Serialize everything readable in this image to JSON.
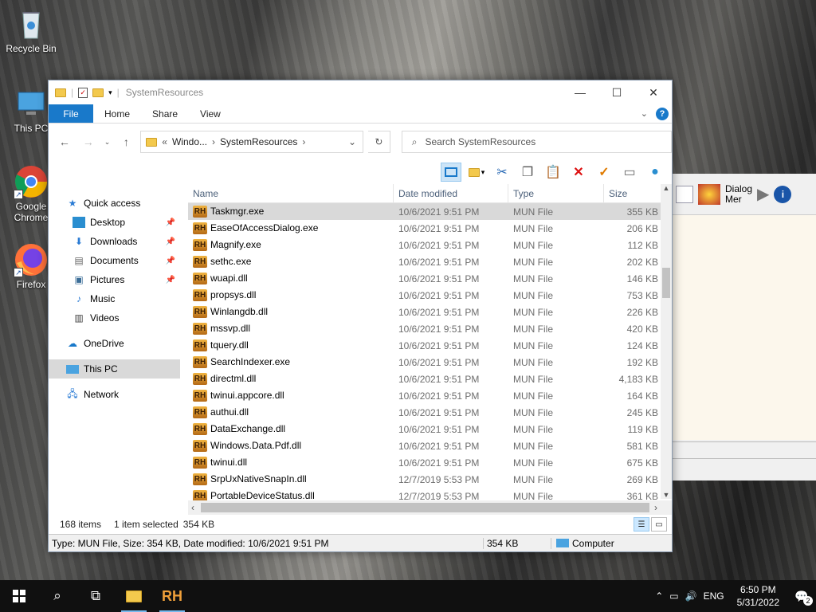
{
  "desktop": {
    "icons": [
      {
        "label": "Recycle Bin"
      },
      {
        "label": "This PC"
      },
      {
        "label": "Google Chrome"
      },
      {
        "label": "Firefox"
      }
    ]
  },
  "bg_app": {
    "dialog_label": "Dialog",
    "menu_label": "Mer"
  },
  "window": {
    "title": "SystemResources",
    "tabs": {
      "file": "File",
      "home": "Home",
      "share": "Share",
      "view": "View"
    },
    "address": {
      "part1": "Windo...",
      "part2": "SystemResources"
    },
    "search_placeholder": "Search SystemResources",
    "nav": {
      "quick_access": "Quick access",
      "desktop": "Desktop",
      "downloads": "Downloads",
      "documents": "Documents",
      "pictures": "Pictures",
      "music": "Music",
      "videos": "Videos",
      "onedrive": "OneDrive",
      "this_pc": "This PC",
      "network": "Network"
    },
    "columns": {
      "name": "Name",
      "date": "Date modified",
      "type": "Type",
      "size": "Size"
    },
    "files": [
      {
        "name": "Taskmgr.exe",
        "date": "10/6/2021 9:51 PM",
        "type": "MUN File",
        "size": "355 KB"
      },
      {
        "name": "EaseOfAccessDialog.exe",
        "date": "10/6/2021 9:51 PM",
        "type": "MUN File",
        "size": "206 KB"
      },
      {
        "name": "Magnify.exe",
        "date": "10/6/2021 9:51 PM",
        "type": "MUN File",
        "size": "112 KB"
      },
      {
        "name": "sethc.exe",
        "date": "10/6/2021 9:51 PM",
        "type": "MUN File",
        "size": "202 KB"
      },
      {
        "name": "wuapi.dll",
        "date": "10/6/2021 9:51 PM",
        "type": "MUN File",
        "size": "146 KB"
      },
      {
        "name": "propsys.dll",
        "date": "10/6/2021 9:51 PM",
        "type": "MUN File",
        "size": "753 KB"
      },
      {
        "name": "Winlangdb.dll",
        "date": "10/6/2021 9:51 PM",
        "type": "MUN File",
        "size": "226 KB"
      },
      {
        "name": "mssvp.dll",
        "date": "10/6/2021 9:51 PM",
        "type": "MUN File",
        "size": "420 KB"
      },
      {
        "name": "tquery.dll",
        "date": "10/6/2021 9:51 PM",
        "type": "MUN File",
        "size": "124 KB"
      },
      {
        "name": "SearchIndexer.exe",
        "date": "10/6/2021 9:51 PM",
        "type": "MUN File",
        "size": "192 KB"
      },
      {
        "name": "directml.dll",
        "date": "10/6/2021 9:51 PM",
        "type": "MUN File",
        "size": "4,183 KB"
      },
      {
        "name": "twinui.appcore.dll",
        "date": "10/6/2021 9:51 PM",
        "type": "MUN File",
        "size": "164 KB"
      },
      {
        "name": "authui.dll",
        "date": "10/6/2021 9:51 PM",
        "type": "MUN File",
        "size": "245 KB"
      },
      {
        "name": "DataExchange.dll",
        "date": "10/6/2021 9:51 PM",
        "type": "MUN File",
        "size": "119 KB"
      },
      {
        "name": "Windows.Data.Pdf.dll",
        "date": "10/6/2021 9:51 PM",
        "type": "MUN File",
        "size": "581 KB"
      },
      {
        "name": "twinui.dll",
        "date": "10/6/2021 9:51 PM",
        "type": "MUN File",
        "size": "675 KB"
      },
      {
        "name": "SrpUxNativeSnapIn.dll",
        "date": "12/7/2019 5:53 PM",
        "type": "MUN File",
        "size": "269 KB"
      },
      {
        "name": "PortableDeviceStatus.dll",
        "date": "12/7/2019 5:53 PM",
        "type": "MUN File",
        "size": "361 KB"
      }
    ],
    "status": {
      "count": "168 items",
      "selected": "1 item selected",
      "sel_size": "354 KB"
    },
    "info": {
      "details": "Type: MUN File, Size: 354 KB, Date modified: 10/6/2021 9:51 PM",
      "size": "354 KB",
      "location": "Computer"
    }
  },
  "taskbar": {
    "rh_label": "RH",
    "lang": "ENG",
    "time": "6:50 PM",
    "date": "5/31/2022",
    "notifications": "2"
  },
  "colors": {
    "accent": "#1979ca",
    "selection": "#cce8ff",
    "rh_icon": "#d58a27"
  }
}
